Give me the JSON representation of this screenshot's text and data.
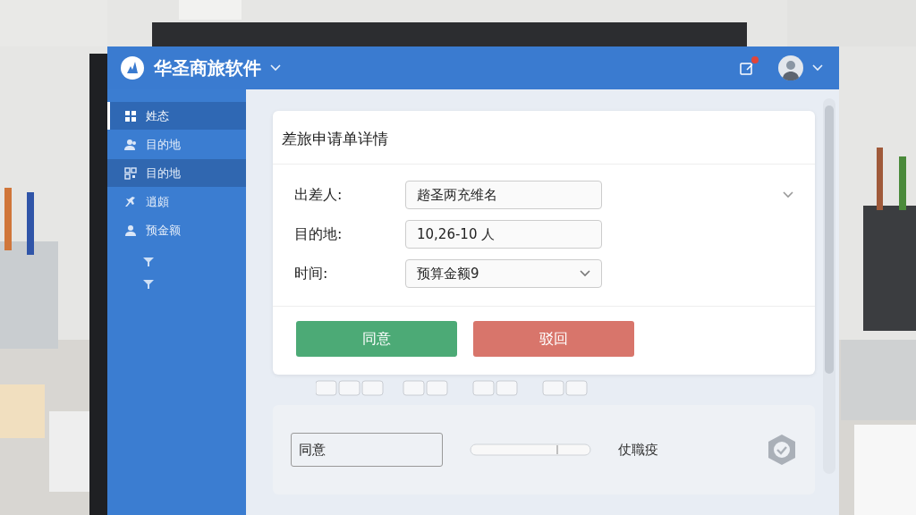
{
  "app": {
    "title": "华圣商旅软件",
    "notification": true
  },
  "sidebar": {
    "items": [
      {
        "label": "姓态",
        "kind": "grid",
        "selected": true,
        "highlighted": false
      },
      {
        "label": "目的地",
        "kind": "people",
        "selected": false,
        "highlighted": false
      },
      {
        "label": "目的地",
        "kind": "qr",
        "selected": false,
        "highlighted": true
      },
      {
        "label": "逍頗",
        "kind": "plane",
        "selected": false,
        "highlighted": false
      },
      {
        "label": "预金额",
        "kind": "person",
        "selected": false,
        "highlighted": false
      }
    ]
  },
  "card": {
    "title": "差旅申请单详情",
    "fields": [
      {
        "label": "出差人:",
        "value": "趦圣两充维名",
        "kind": "text"
      },
      {
        "label": "目的地:",
        "value": "10,26-10 人",
        "kind": "text"
      },
      {
        "label": "时间:",
        "value": "预算金额9",
        "kind": "select"
      }
    ],
    "buttons": [
      {
        "label": "同意",
        "kind": "approve"
      },
      {
        "label": "驳回",
        "kind": "reject"
      }
    ]
  },
  "lower_panel": {
    "field_value": "同意",
    "label": "仗職疫"
  }
}
